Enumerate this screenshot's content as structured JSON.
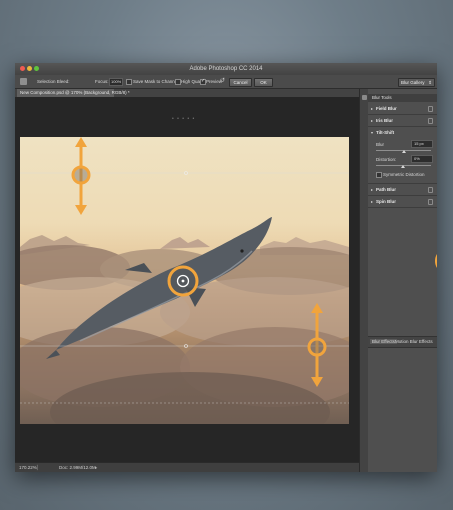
{
  "window": {
    "title": "Adobe Photoshop CC 2014"
  },
  "options_bar": {
    "selection_bleed_label": "Selection Bleed:",
    "focus_label": "Focus:",
    "focus_value": "100%",
    "save_mask_label": "Save Mask to Channels",
    "save_mask_checked": false,
    "high_quality_label": "High Quality",
    "high_quality_checked": false,
    "preview_label": "Preview",
    "preview_checked": true,
    "cancel_label": "Cancel",
    "ok_label": "OK",
    "workspace_dropdown": "Blur Gallery"
  },
  "document_tab": {
    "label": "New Composition.psd @ 170% (Background, RGB/8) *"
  },
  "canvas": {
    "top_marks": "• • • • •"
  },
  "status_bar": {
    "zoom": "170.22%",
    "doc_info": "Doc: 2.99M/12.0M"
  },
  "blur_tools": {
    "title": "Blur Tools",
    "sections": [
      {
        "name": "Field Blur",
        "expanded": false
      },
      {
        "name": "Iris Blur",
        "expanded": false
      },
      {
        "name": "Tilt-Shift",
        "expanded": true
      },
      {
        "name": "Path Blur",
        "expanded": false
      },
      {
        "name": "Spin Blur",
        "expanded": false
      }
    ],
    "tilt_shift": {
      "blur_label": "Blur",
      "blur_value": "15 px",
      "distortion_label": "Distortion:",
      "distortion_value": "0%",
      "symmetric_label": "Symmetric Distortion",
      "symmetric_checked": false
    }
  },
  "effects_tabs": {
    "blur_effects": "Blur Effects",
    "motion_blur_effects": "Motion Blur Effects"
  },
  "colors": {
    "accent": "#f1a43c",
    "panel_bg": "#4f4f4f",
    "canvas_bg": "#262626"
  }
}
